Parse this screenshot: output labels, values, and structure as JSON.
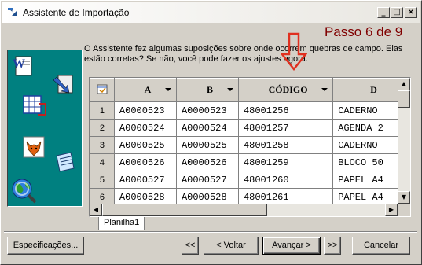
{
  "window": {
    "title": "Assistente de Importação",
    "controls": {
      "minimize": "_",
      "maximize": "□",
      "close": "×"
    }
  },
  "step_label": "Passo 6 de 9",
  "instruction": "O Assistente fez algumas suposições sobre onde ocorrem quebras de campo. Elas estão corretas? Se não, você pode fazer os ajustes agora.",
  "grid": {
    "columns": [
      "A",
      "B",
      "CÓDIGO",
      "D"
    ],
    "rows": [
      {
        "num": "1",
        "cells": [
          "A0000523",
          "A0000523",
          "48001256",
          "CADERNO"
        ]
      },
      {
        "num": "2",
        "cells": [
          "A0000524",
          "A0000524",
          "48001257",
          "AGENDA 2"
        ]
      },
      {
        "num": "3",
        "cells": [
          "A0000525",
          "A0000525",
          "48001258",
          "CADERNO"
        ]
      },
      {
        "num": "4",
        "cells": [
          "A0000526",
          "A0000526",
          "48001259",
          "BLOCO 50"
        ]
      },
      {
        "num": "5",
        "cells": [
          "A0000527",
          "A0000527",
          "48001260",
          "PAPEL A4"
        ]
      },
      {
        "num": "6",
        "cells": [
          "A0000528",
          "A0000528",
          "48001261",
          "PAPEL A4"
        ]
      }
    ],
    "sheet_tab": "Planilha1"
  },
  "buttons": {
    "specs": "Especificações...",
    "first": "<<",
    "back": "< Voltar",
    "next": "Avançar >",
    "last": ">>",
    "cancel": "Cancelar"
  },
  "colors": {
    "step": "#800000",
    "panel": "#008080",
    "arrow": "#e03020"
  },
  "icons": [
    "word-icon",
    "excel-icon",
    "foxpro-icon",
    "notepad-icon",
    "globe-icon",
    "import-arrow-icon"
  ]
}
